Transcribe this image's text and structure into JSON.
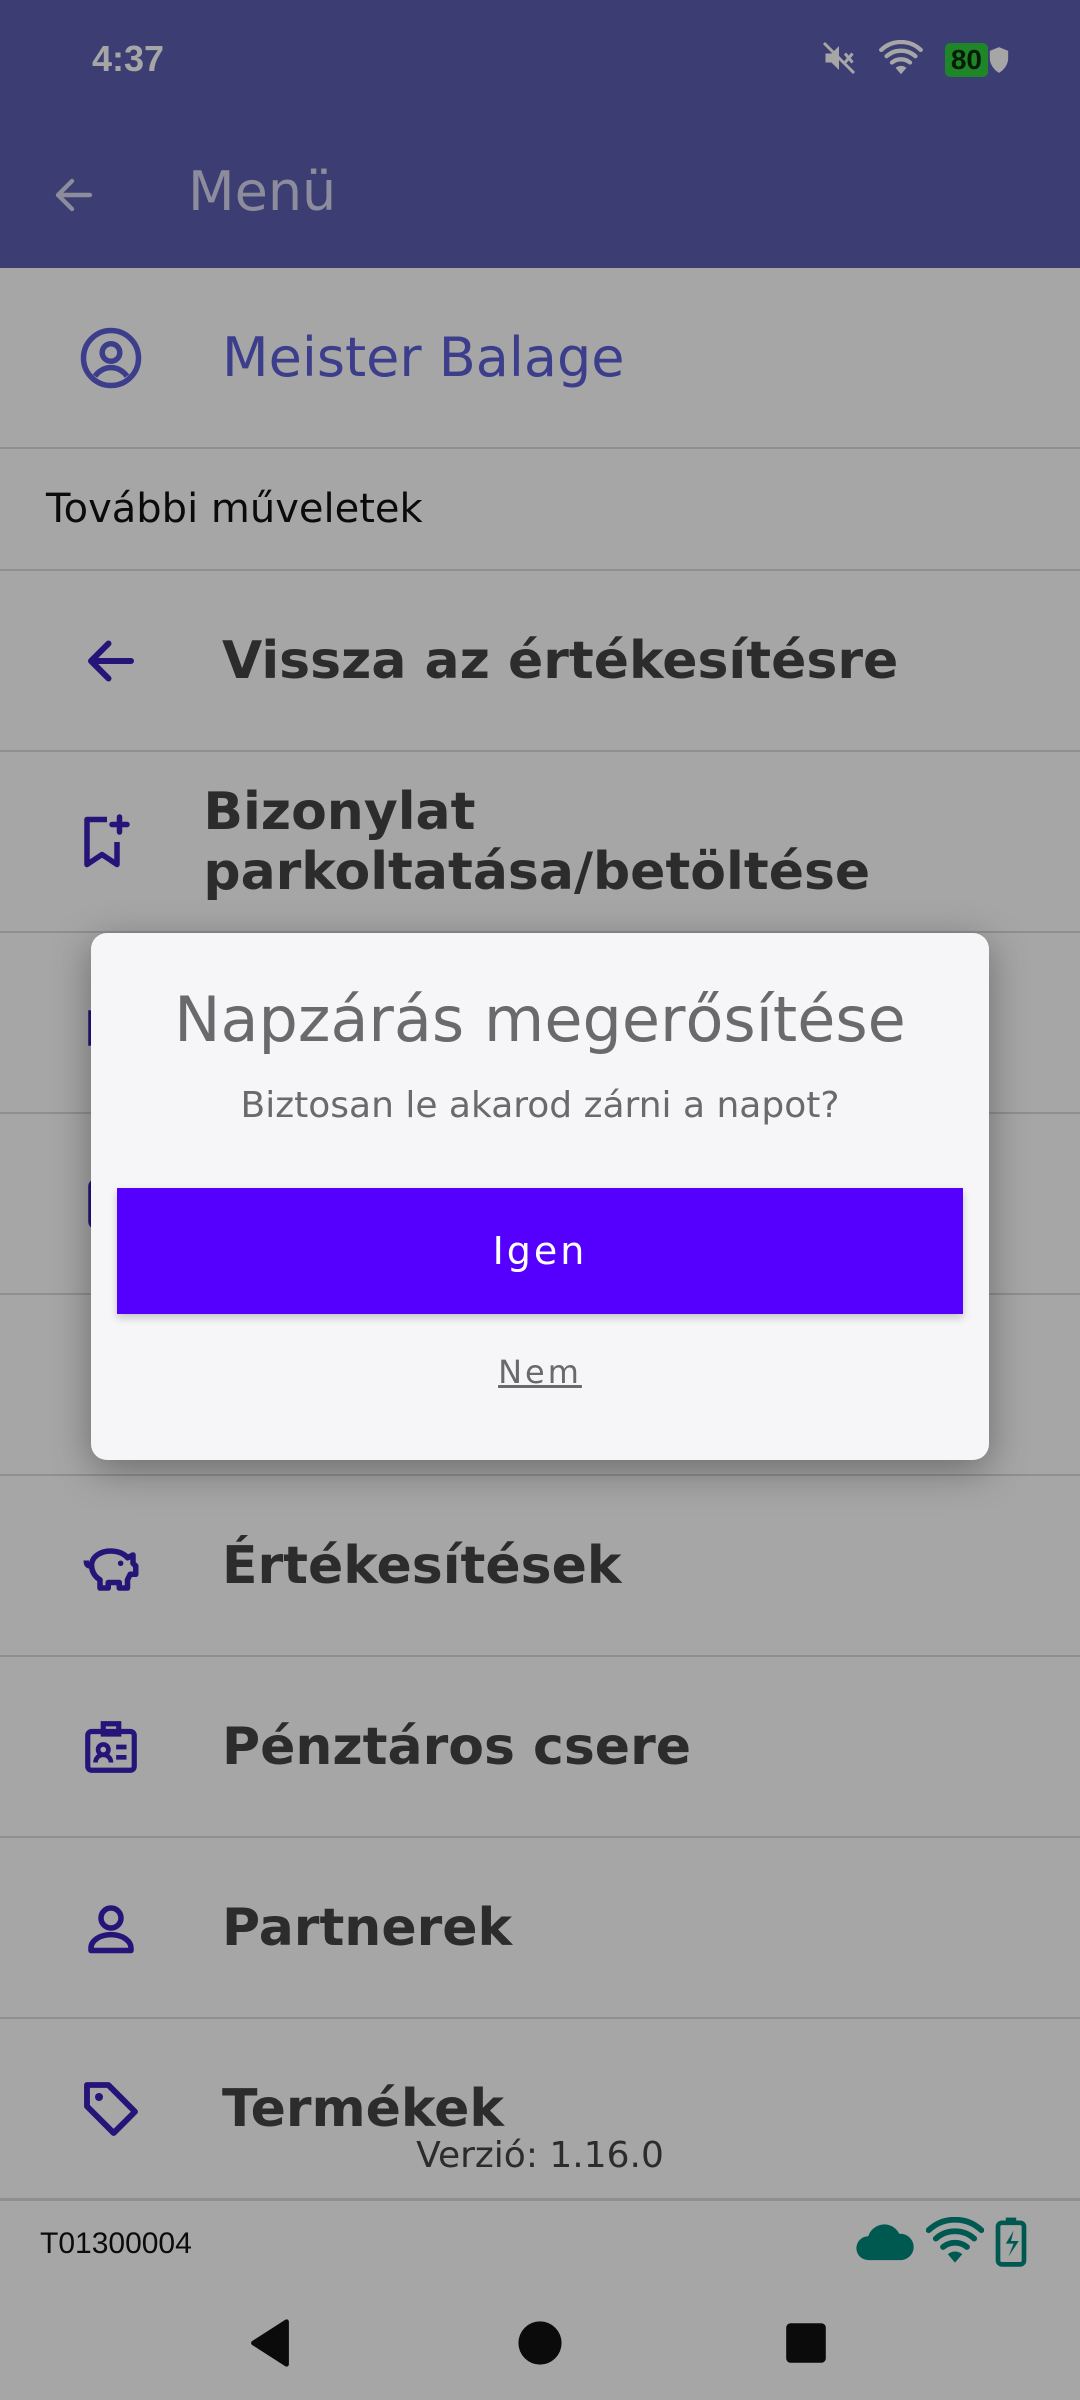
{
  "status_bar": {
    "time": "4:37",
    "battery": "80"
  },
  "app_bar": {
    "title": "Menü"
  },
  "user": {
    "name": "Meister Balage"
  },
  "section": {
    "title": "További műveletek"
  },
  "menu_items": [
    {
      "label": "Vissza az értékesítésre",
      "icon": "arrow-left-icon"
    },
    {
      "label": "Bizonylat parkoltatása/betöltése",
      "icon": "bookmark-plus-icon"
    },
    {
      "label": "",
      "icon": "hidden-item-icon"
    },
    {
      "label": "",
      "icon": "hidden-item-icon"
    },
    {
      "label": "",
      "icon": "hidden-item-icon"
    },
    {
      "label": "Értékesítések",
      "icon": "piggy-bank-icon"
    },
    {
      "label": "Pénztáros csere",
      "icon": "id-badge-icon"
    },
    {
      "label": "Partnerek",
      "icon": "user-icon"
    },
    {
      "label": "Termékek",
      "icon": "tag-icon"
    }
  ],
  "footer": {
    "version": "Verzió: 1.16.0",
    "terminal_id": "T01300004"
  },
  "dialog": {
    "title": "Napzárás megerősítése",
    "text": "Biztosan le akarod zárni a napot?",
    "confirm_label": "Igen",
    "cancel_label": "Nem"
  },
  "colors": {
    "primary": "#5c5fb0",
    "accent": "#5500ff",
    "icon": "#3b1fb8",
    "status_ok": "#00897b"
  }
}
